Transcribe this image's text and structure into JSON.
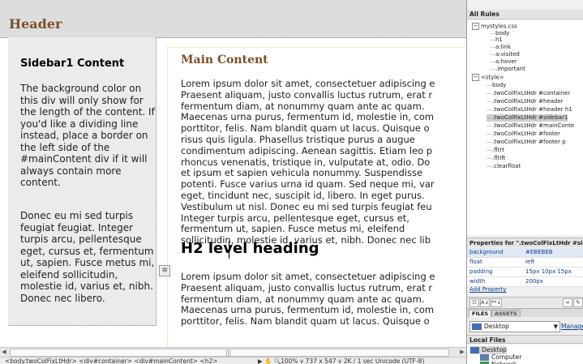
{
  "header": {
    "title": "Header"
  },
  "sidebar": {
    "title": "Sidebar1 Content",
    "para1": "The background color on this div will only show for the length of the content. If you'd like a dividing line instead, place a border on the left side of the #mainContent div if it will always contain more content.",
    "para2": "Donec eu mi sed turpis feugiat feugiat. Integer turpis arcu, pellentesque eget, cursus et, fermentum ut, sapien. Fusce metus mi, eleifend sollicitudin, molestie id, varius et, nibh. Donec nec libero."
  },
  "main": {
    "title": "Main Content",
    "para1_lines": [
      "Lorem ipsum dolor sit amet, consectetuer adipiscing e",
      "Praesent aliquam, justo convallis luctus rutrum, erat r",
      "fermentum diam, at nonummy quam ante ac quam.",
      "Maecenas urna purus, fermentum id, molestie in, com",
      "porttitor, felis. Nam blandit quam ut lacus. Quisque o",
      "risus quis ligula. Phasellus tristique purus a augue",
      "condimentum adipiscing. Aenean sagittis. Etiam leo p",
      "rhoncus venenatis, tristique in, vulputate at, odio. Do",
      "et ipsum et sapien vehicula nonummy. Suspendisse",
      "potenti. Fusce varius urna id quam. Sed neque mi, var",
      "eget, tincidunt nec, suscipit id, libero. In eget purus.",
      "Vestibulum ut nisl. Donec eu mi sed turpis feugiat feu",
      "Integer turpis arcu, pellentesque eget, cursus et,",
      "fermentum ut, sapien. Fusce metus mi, eleifend",
      "sollicitudin, molestie id, varius et, nibh. Donec nec lib"
    ],
    "h2": "H2 level heading",
    "para2_lines": [
      "Lorem ipsum dolor sit amet, consectetuer adipiscing e",
      "Praesent aliquam, justo convallis luctus rutrum, erat r",
      "fermentum diam, at nonummy quam ante ac quam.",
      "Maecenas urna purus, fermentum id, molestie in, com",
      "porttitor, felis. Nam blandit quam ut lacus. Quisque o"
    ]
  },
  "status": {
    "tag_selector": "<body.twoColFixLtHdr> <div#container> <div#mainContent> <h2>",
    "zoom": "100%",
    "info": "100%   v  737 x 547 v  2K / 1 sec  Unicode (UTF-8)"
  },
  "panel": {
    "rules_title": "All Rules",
    "tree": [
      "mystyles.css",
      "body",
      "h1",
      "a:link",
      "a:visited",
      "a:hover",
      ".important",
      "<style>",
      "body",
      ".twoColFixLtHdr #container",
      ".twoColFixLtHdr #header",
      ".twoColFixLtHdr #header h1",
      ".twoColFixLtHdr #sidebar1",
      ".twoColFixLtHdr #mainConte",
      ".twoColFixLtHdr #footer",
      ".twoColFixLtHdr #footer p",
      ".fltrt",
      ".fltlft",
      ".clearfloat"
    ],
    "props_title": "Properties for \".twoColFixLtHdr #sid",
    "props": [
      {
        "name": "background",
        "value": "#EBEBEB"
      },
      {
        "name": "float",
        "value": "left"
      },
      {
        "name": "padding",
        "value": "15px 10px 15px"
      },
      {
        "name": "width",
        "value": "200px"
      }
    ],
    "add_property": "Add Property",
    "files_tab": "FILES",
    "assets_tab": "ASSETS",
    "site": "Desktop",
    "manage_sites": "Manage",
    "local_files": "Local Files",
    "files": [
      "Desktop",
      "Computer",
      "Network"
    ]
  },
  "colors": {
    "heading_brown": "#7a4f25",
    "sidebar_bg": "#ebebeb",
    "link_blue": "#0b3e8f"
  }
}
